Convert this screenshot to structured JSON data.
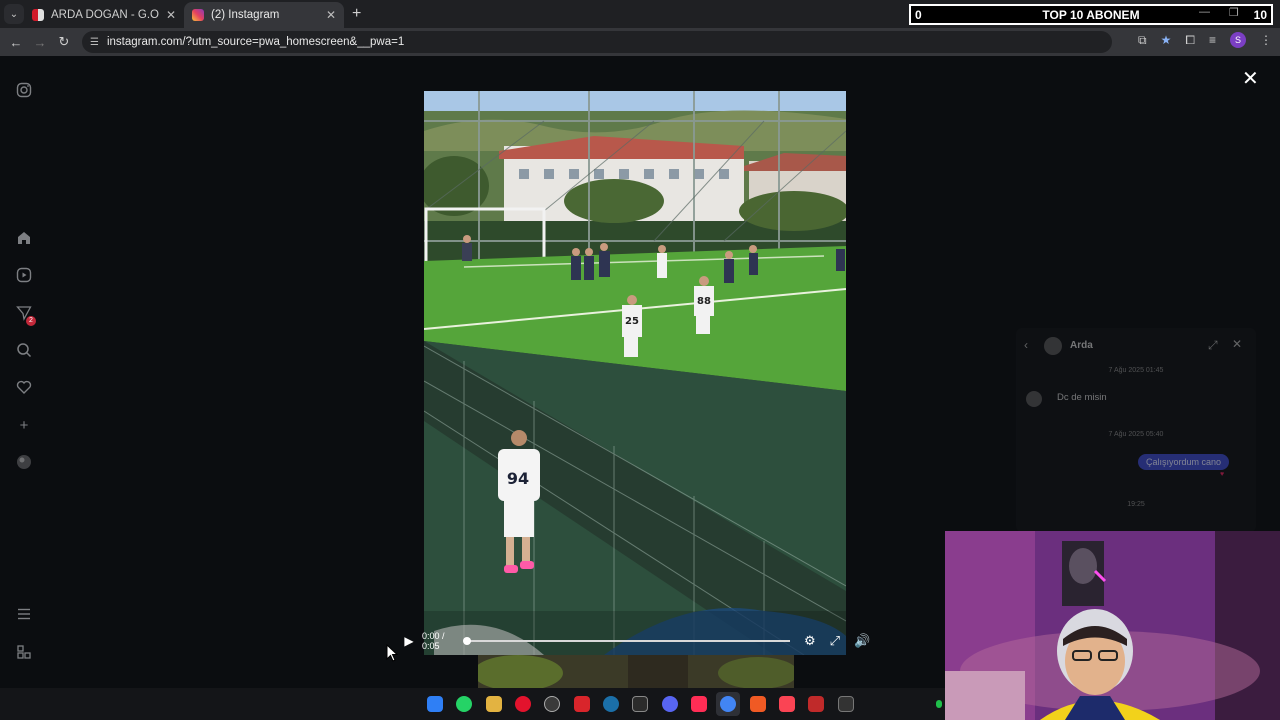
{
  "browser": {
    "tabs": [
      {
        "title": "ARDA DOĞAN - G.O.P.VENÜS",
        "active": false
      },
      {
        "title": "(2) Instagram",
        "active": true
      }
    ],
    "url": "instagram.com/?utm_source=pwa_homescreen&__pwa=1",
    "profile_initial": "S"
  },
  "overlay": {
    "left_value": "0",
    "center_text": "TOP 10 ABONEM",
    "right_value": "10"
  },
  "sidebar": {
    "icons": [
      "instagram-logo-icon",
      "home-icon",
      "reels-icon",
      "messages-icon",
      "search-icon",
      "heart-icon",
      "create-icon",
      "profile-icon",
      "menu-icon",
      "more-icon"
    ],
    "messages_badge": "2"
  },
  "video": {
    "time": "0:00 / 0:05",
    "progress": 0.0,
    "players": [
      {
        "number": "94"
      },
      {
        "number": "25"
      },
      {
        "number": "88"
      }
    ]
  },
  "chat": {
    "name": "Arda",
    "stamp1": "7 Ağu 2025 01:45",
    "incoming": "Dc de misin",
    "stamp2": "7 Ağu 2025 05:40",
    "outgoing": "Çalışıyordum cano",
    "stamp3": "19:25"
  },
  "taskbar": {
    "apps": [
      "windows-start-icon",
      "whatsapp-icon",
      "folder-icon",
      "opera-icon",
      "obs-icon",
      "app-red-icon",
      "steam-icon",
      "epic-games-icon",
      "discord-icon",
      "tiktok-icon",
      "chrome-icon",
      "app-orange-icon",
      "valorant-icon",
      "app-stripe-icon",
      "terminal-icon"
    ],
    "colors": {
      "windows": "#2f7ff5",
      "whatsapp": "#25d366",
      "folder": "#e3b341",
      "opera": "#e3132d",
      "obs": "#3a3a3a",
      "red": "#d9252b",
      "steam": "#1b6fa8",
      "epic": "#2b2b2b",
      "discord": "#5865f2",
      "tiktok": "#ff2d55",
      "chrome": "#4285f4",
      "orange": "#f05a24",
      "valorant": "#fa4454",
      "stripe": "#c02a2a",
      "terminal": "#333333"
    }
  }
}
